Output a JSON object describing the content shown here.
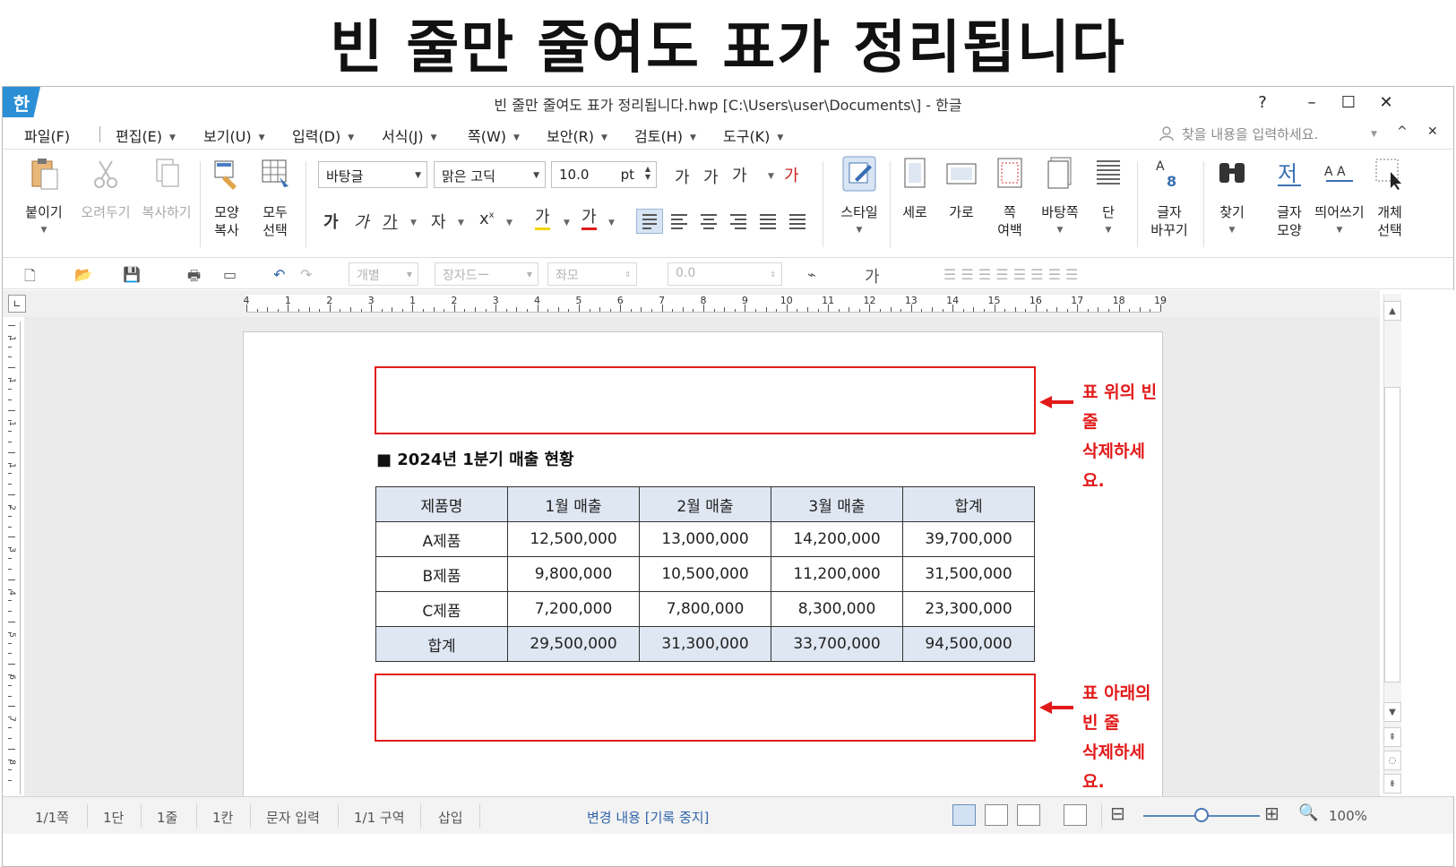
{
  "headline": "빈 줄만 줄여도 표가 정리됩니다",
  "titlebar": {
    "app_badge": "한",
    "title": "빈 줄만 줄여도 표가 정리됩니다.hwp [C:\\Users\\user\\Documents\\] - 한글",
    "help": "?",
    "minimize": "–",
    "maximize": "☐",
    "close": "✕"
  },
  "menubar": {
    "items": [
      "파일(F)",
      "편집(E)",
      "보기(U)",
      "입력(D)",
      "서식(J)",
      "쪽(W)",
      "보안(R)",
      "검토(H)",
      "도구(K)"
    ],
    "search_placeholder": "찾을 내용을 입력하세요.",
    "collapse": "^",
    "close": "✕"
  },
  "ribbon": {
    "paste": "붙이기",
    "cut": "오려두기",
    "copy": "복사하기",
    "format_copy": [
      "모양",
      "복사"
    ],
    "select_all": [
      "모두",
      "선택"
    ],
    "style_combo": "바탕글",
    "font_combo": "맑은 고딕",
    "size_value": "10.0",
    "size_unit": "pt",
    "style": "스타일",
    "portrait": "세로",
    "landscape": "가로",
    "page_margin": [
      "쪽",
      "여백"
    ],
    "background_page": "바탕쪽",
    "columns": "단",
    "char_replace": [
      "글자",
      "바꾸기"
    ],
    "find": "찾기",
    "char_shape": [
      "글자",
      "모양"
    ],
    "spacing": "띄어쓰기",
    "object_select": [
      "개체",
      "선택"
    ]
  },
  "quickbar": {
    "para_style": "개별",
    "char_style": "장자드ー",
    "line_spacing": "좌모",
    "indent_value": "0.0",
    "char_label": "가"
  },
  "ruler": {
    "top_numbers": [
      "4",
      "1",
      "2",
      "3",
      "1",
      "2",
      "3",
      "4",
      "5",
      "6",
      "7",
      "8",
      "9",
      "10",
      "11",
      "12",
      "13",
      "14",
      "15",
      "16",
      "17",
      "18",
      "19"
    ],
    "left_numbers": [
      "1",
      "1",
      "1",
      "1",
      "2",
      "3",
      "4",
      "5",
      "6",
      "7",
      "8"
    ]
  },
  "document": {
    "heading": "■  2024년 1분기 매출 현황",
    "table": {
      "headers": [
        "제품명",
        "1월 매출",
        "2월 매출",
        "3월 매출",
        "합계"
      ],
      "rows": [
        [
          "A제품",
          "12,500,000",
          "13,000,000",
          "14,200,000",
          "39,700,000"
        ],
        [
          "B제품",
          "9,800,000",
          "10,500,000",
          "11,200,000",
          "31,500,000"
        ],
        [
          "C제품",
          "7,200,000",
          "7,800,000",
          "8,300,000",
          "23,300,000"
        ]
      ],
      "total": [
        "합계",
        "29,500,000",
        "31,300,000",
        "33,700,000",
        "94,500,000"
      ]
    },
    "callout_top": [
      "표 위의 빈 줄",
      "삭제하세요."
    ],
    "callout_bottom": [
      "표 아래의 빈 줄",
      "삭제하세요."
    ],
    "annotation_color": "#e21a1a"
  },
  "statusbar": {
    "page": "1/1쪽",
    "column": "1단",
    "line": "1줄",
    "cell": "1칸",
    "mode": "문자 입력",
    "section": "1/1 구역",
    "insert": "삽입",
    "track_changes": "변경 내용 [기록 중지]",
    "zoom": "100%"
  }
}
